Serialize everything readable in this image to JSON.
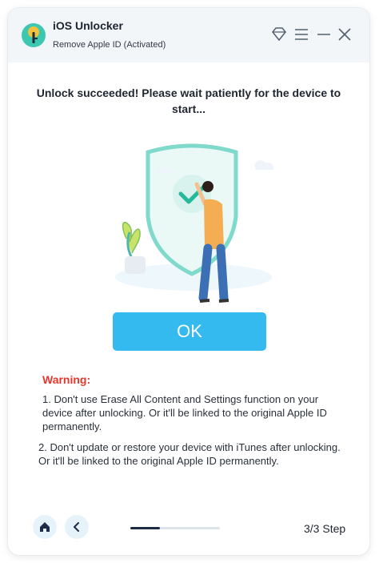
{
  "app": {
    "title": "iOS Unlocker",
    "subtitle": "Remove Apple ID  (Activated)"
  },
  "window_controls": [
    "diamond-icon",
    "menu-icon",
    "minimize-icon",
    "close-icon"
  ],
  "headline": "Unlock succeeded! Please wait patiently for the device to start...",
  "ok_button": "OK",
  "warning": {
    "title": "Warning:",
    "items": [
      "1. Don't use Erase All Content and Settings function on your device after unlocking. Or it'll be linked to the original Apple ID permanently.",
      "2. Don't update or restore your device with iTunes after unlocking. Or it'll be linked to the original Apple ID permanently."
    ]
  },
  "footer": {
    "step": "3/3 Step",
    "progress": 0.33
  },
  "colors": {
    "accent": "#35baf0",
    "warning": "#e3372e",
    "progress": "#1e2b46"
  }
}
